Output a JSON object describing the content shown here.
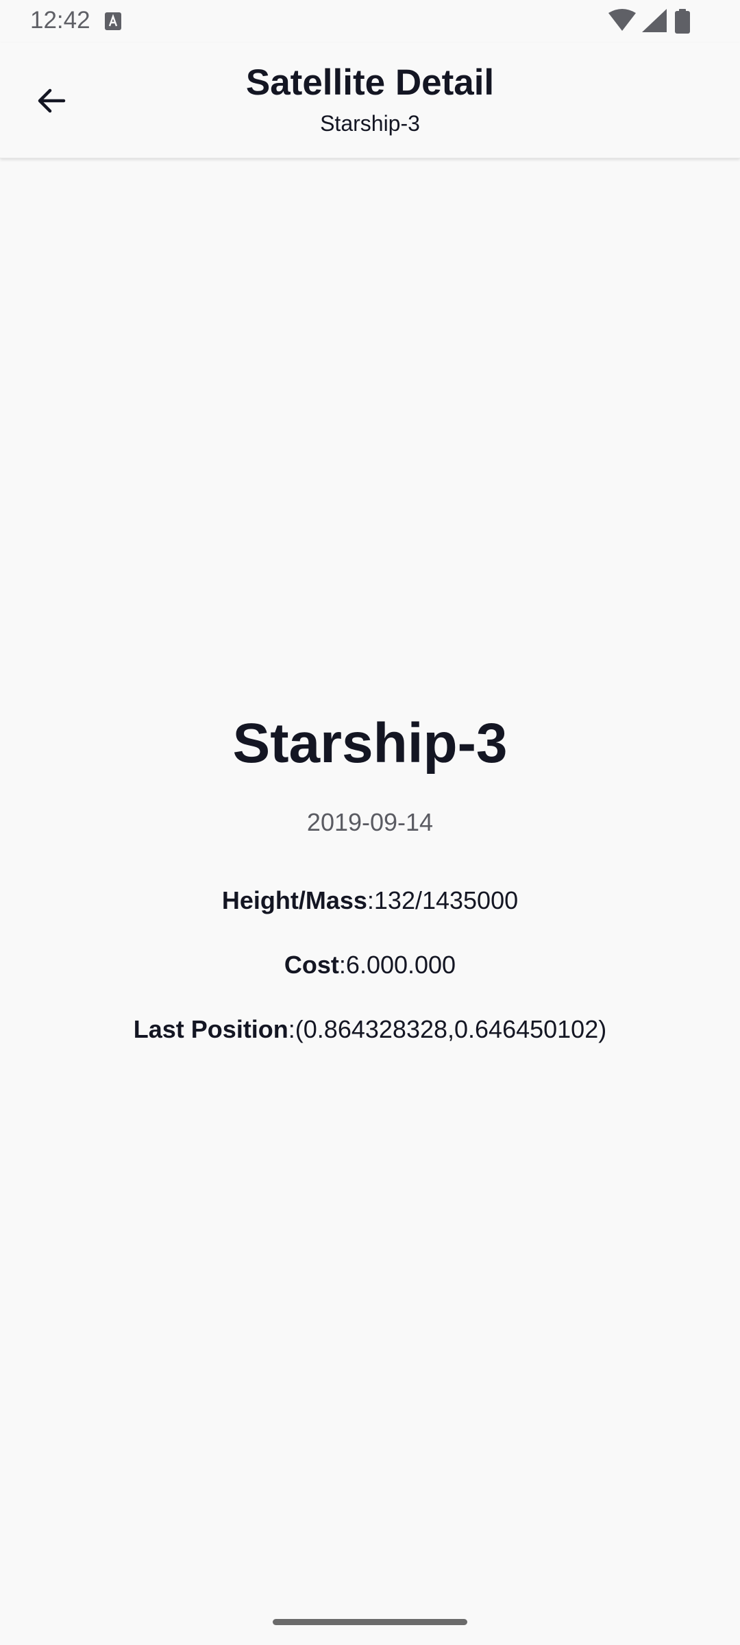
{
  "status_bar": {
    "time": "12:42",
    "icons": [
      "a-notification-icon",
      "wifi-icon",
      "cell-signal-icon",
      "battery-icon"
    ]
  },
  "app_bar": {
    "back_icon": "arrow-left-icon",
    "title": "Satellite Detail",
    "subtitle": "Starship-3"
  },
  "satellite": {
    "name": "Starship-3",
    "date": "2019-09-14",
    "height_mass_label": "Height/Mass",
    "height_mass_value": ":132/1435000",
    "cost_label": "Cost",
    "cost_value": ":6.000.000",
    "last_position_label": "Last Position",
    "last_position_value": ":(0.864328328,0.646450102)"
  },
  "colors": {
    "background": "#f9f9f9",
    "text_primary": "#141623",
    "text_secondary": "#5a5b62"
  }
}
